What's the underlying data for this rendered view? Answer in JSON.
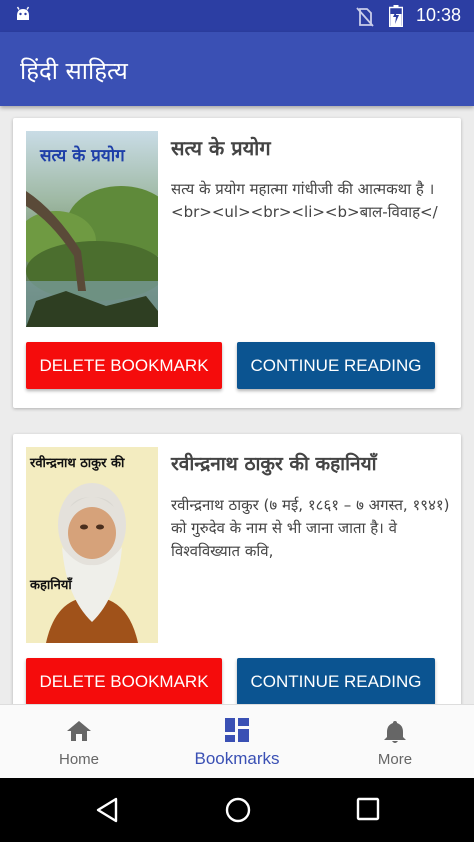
{
  "status_bar": {
    "time": "10:38"
  },
  "app_bar": {
    "title": "हिंदी साहित्य"
  },
  "books": [
    {
      "cover_text": "सत्य के प्रयोग",
      "title": "सत्य के प्रयोग",
      "description": "सत्य के प्रयोग महात्मा गांधीजी की आत्मकथा है । <br><ul><br><li><b>बाल-विवाह</",
      "delete_label": "DELETE BOOKMARK",
      "continue_label": "CONTINUE READING"
    },
    {
      "cover_text": "रवीन्द्रनाथ ठाकुर की",
      "cover_text_bottom": "कहानियाँ",
      "title": "रवीन्द्रनाथ ठाकुर की कहानियाँ",
      "description": "रवीन्द्रनाथ ठाकुर (७ मई, १८६१ – ७ अगस्त, १९४१) को गुरुदेव के नाम से भी जाना जाता है। वे विश्वविख्यात कवि,",
      "delete_label": "DELETE BOOKMARK",
      "continue_label": "CONTINUE READING"
    }
  ],
  "bottom_nav": [
    {
      "label": "Home",
      "icon": "home-icon",
      "active": false
    },
    {
      "label": "Bookmarks",
      "icon": "dashboard-icon",
      "active": true
    },
    {
      "label": "More",
      "icon": "bell-icon",
      "active": false
    }
  ],
  "colors": {
    "primary": "#3a50b4",
    "status_bar": "#2c3ea3",
    "delete": "#f50c0c",
    "continue": "#0b5491"
  }
}
